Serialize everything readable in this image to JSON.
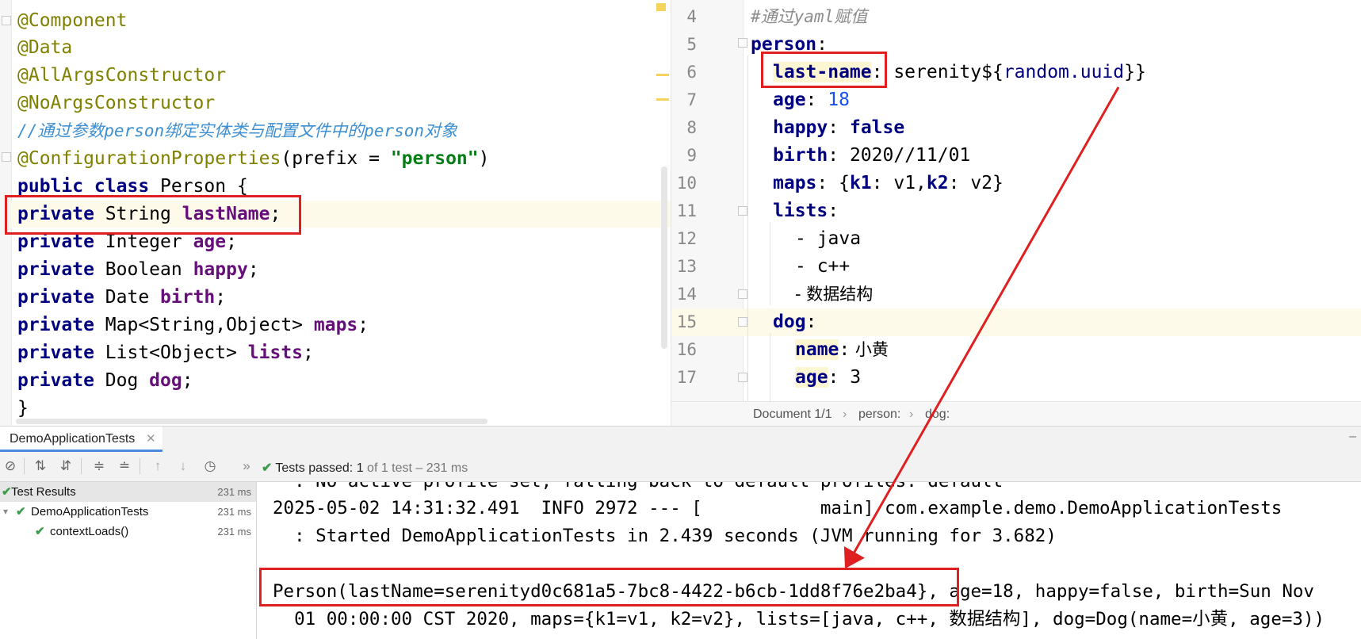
{
  "java_code": {
    "lines": [
      "@Component",
      "@Data",
      "@AllArgsConstructor",
      "@NoArgsConstructor",
      "//通过参数person绑定实体类与配置文件中的person对象",
      "@ConfigurationProperties",
      "(prefix = ",
      "\"person\"",
      ")",
      "public class ",
      "Person {",
      "private ",
      "String ",
      "lastName",
      ";",
      "Integer ",
      "age",
      "Boolean ",
      "happy",
      "Date ",
      "birth",
      "Map<String,Object> ",
      "maps",
      "List<Object> ",
      "lists",
      "Dog ",
      "dog",
      "}"
    ]
  },
  "yaml": {
    "line_numbers": [
      "4",
      "5",
      "6",
      "7",
      "8",
      "9",
      "10",
      "11",
      "12",
      "13",
      "14",
      "15",
      "16",
      "17"
    ],
    "comment": "#通过yaml赋值",
    "person_key": "person",
    "last_name_key": "last-name",
    "last_name_value_prefix": " serenity${",
    "last_name_expr": "random.uuid",
    "last_name_value_suffix": "}}",
    "age_key": "age",
    "age_value": "18",
    "happy_key": "happy",
    "happy_value": "false",
    "birth_key": "birth",
    "birth_value": " 2020//11/01",
    "maps_key": "maps",
    "maps_open": " {",
    "k1_key": "k1",
    "k1_value": " v1,",
    "k2_key": "k2",
    "k2_value": " v2}",
    "lists_key": "lists",
    "list_items": [
      "- java",
      "- c++",
      "- 数据结构"
    ],
    "dog_key": "dog",
    "dog_name_key": "name",
    "dog_name_value": " 小黄",
    "dog_age_key": "age",
    "dog_age_value": " 3",
    "colon": ":"
  },
  "breadcrumb": {
    "document": "Document 1/1",
    "sep": "›",
    "item1": "person:",
    "item2": "dog:"
  },
  "run_panel": {
    "tab_label": "DemoApplicationTests",
    "tab_close": "✕",
    "status_prefix": "Tests passed:",
    "status_count": "1",
    "status_rest": "of 1 test – 231 ms",
    "more": "»"
  },
  "test_tree": {
    "rows": [
      {
        "label": "Test Results",
        "time": "231 ms"
      },
      {
        "label": "DemoApplicationTests",
        "time": "231 ms"
      },
      {
        "label": "contextLoads()",
        "time": "231 ms"
      }
    ]
  },
  "console": {
    "lines": [
      "  : No active profile set, falling back to default profiles: default",
      "2025-05-02 14:31:32.491  INFO 2972 --- [           main] com.example.demo.DemoApplicationTests",
      "  : Started DemoApplicationTests in 2.439 seconds (JVM running for 3.682)",
      "Person(lastName=serenityd0c681a5-7bc8-4422-b6cb-1dd8f76e2ba4}, age=18, happy=false, birth=Sun Nov",
      "  01 00:00:00 CST 2020, maps={k1=v1, k2=v2}, lists=[java, c++, 数据结构], dog=Dog(name=小黄, age=3))"
    ]
  },
  "colors": {
    "highlight_box": "#e02020",
    "annotation": "#808000",
    "keyword": "#000080",
    "field": "#660e7a",
    "string": "#067d17",
    "comment": "#3d8fd1",
    "pass": "#3d9c4b"
  }
}
